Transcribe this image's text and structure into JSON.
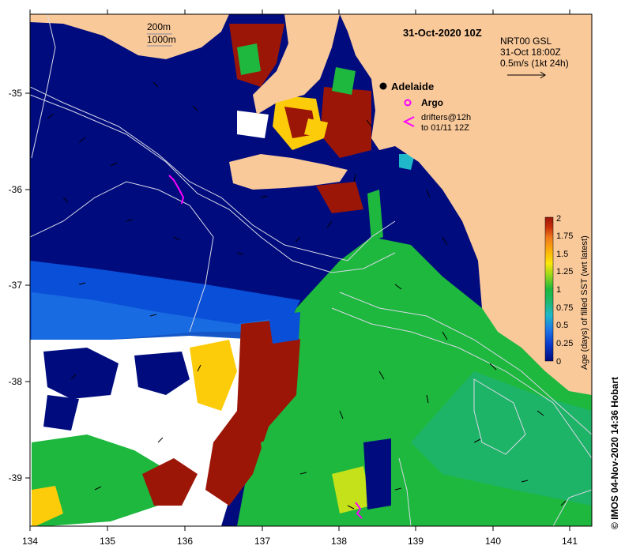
{
  "map": {
    "title": "31-Oct-2020 10Z",
    "product_lines": [
      "NRT00 GSL",
      "31-Oct 18:00Z",
      "0.5m/s (1kt 24h)"
    ],
    "depth_contours": [
      "200m",
      "1000m"
    ],
    "city_label": "Adelaide",
    "argo_label": "Argo",
    "drifter_lines": [
      "drifters@12h",
      "to 01/11 12Z"
    ],
    "x_ticks": [
      "134",
      "135",
      "136",
      "137",
      "138",
      "139",
      "140",
      "141"
    ],
    "y_ticks": [
      "-35",
      "-36",
      "-37",
      "-38",
      "-39"
    ],
    "credit": "© IMOS 04-Nov-2020 14:36 Hobart",
    "colors": {
      "land": "#FAC99A",
      "deep_blue": "#000C7E",
      "mid_blue": "#0A4FD8",
      "teal": "#1FB8A0",
      "green": "#1DB83D",
      "yellow_green": "#C4E11A",
      "yellow": "#FCCC0A",
      "orange": "#F08C1A",
      "dark_red": "#9C1608",
      "argo": "#FF00FF"
    }
  },
  "colorbar": {
    "label": "Age (days) of filled SST (wrt latest)",
    "ticks": [
      "2",
      "1.75",
      "1.5",
      "1.25",
      "1",
      "0.75",
      "0.5",
      "0.25",
      "0"
    ],
    "stops": [
      "#000C7E",
      "#0A3CCC",
      "#1E78E6",
      "#1FB8C8",
      "#1DB86A",
      "#1DB83D",
      "#9CD81A",
      "#FCE60A",
      "#FCB40A",
      "#F0781A",
      "#C8300A",
      "#9C1608"
    ]
  }
}
